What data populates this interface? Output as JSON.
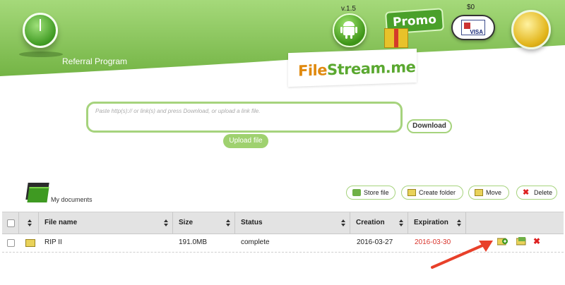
{
  "header": {
    "referral_label": "Referral Program",
    "version": "v.1.5",
    "promo_label": "Promo",
    "balance": "$0",
    "logo": {
      "prefix": "File",
      "suffix": "Stream.me"
    },
    "visa_text": "VISA"
  },
  "upload": {
    "placeholder": "Paste http(s):// or link(s) and press Download, or upload a link file.",
    "upload_label": "Upload file",
    "download_label": "Download"
  },
  "documents": {
    "title": "My documents",
    "toolbar": {
      "store_label": "Store file",
      "create_folder_label": "Create folder",
      "move_label": "Move",
      "delete_label": "Delete"
    }
  },
  "table": {
    "columns": [
      "File name",
      "Size",
      "Status",
      "Creation",
      "Expiration"
    ],
    "rows": [
      {
        "name": "RIP II",
        "size": "191.0MB",
        "status": "complete",
        "creation": "2016-03-27",
        "expiration": "2016-03-30"
      }
    ]
  },
  "colors": {
    "brand_green": "#8cc95a",
    "accent_light_green": "#a6d37d",
    "expiration_red": "#d8322a",
    "arrow_red": "#e8402a"
  }
}
